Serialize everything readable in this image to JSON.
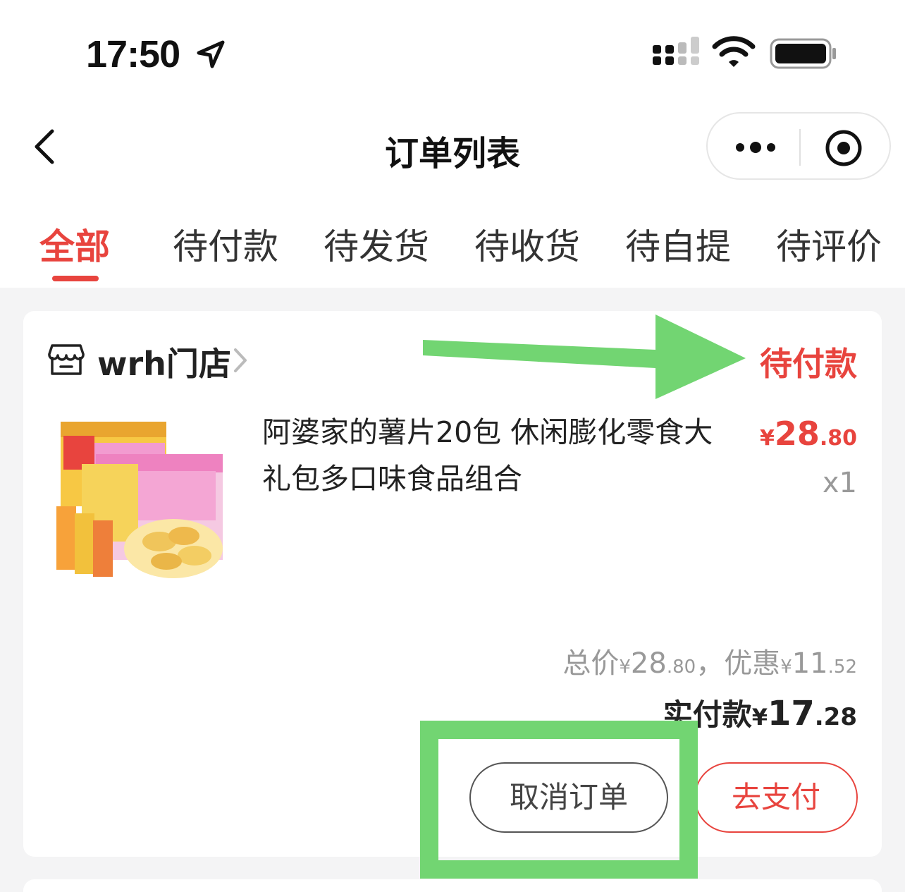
{
  "status_bar": {
    "time": "17:50"
  },
  "nav": {
    "title": "订单列表"
  },
  "tabs": [
    {
      "label": "全部",
      "active": true
    },
    {
      "label": "待付款",
      "active": false
    },
    {
      "label": "待发货",
      "active": false
    },
    {
      "label": "待收货",
      "active": false
    },
    {
      "label": "待自提",
      "active": false
    },
    {
      "label": "待评价",
      "active": false
    }
  ],
  "order": {
    "store_name": "wrh门店",
    "status": "待付款",
    "product": {
      "title": "阿婆家的薯片20包 休闲膨化零食大礼包多口味食品组合",
      "price_symbol": "¥",
      "price_int": "28",
      "price_dec": ".80",
      "quantity": "x1"
    },
    "summary": {
      "total_label": "总价",
      "total_symbol": "¥",
      "total_int": "28",
      "total_dec": ".80",
      "sep": "，",
      "discount_label": "优惠",
      "discount_symbol": "¥",
      "discount_int": "11",
      "discount_dec": ".52"
    },
    "paid": {
      "label": "实付款",
      "symbol": "¥",
      "int": "17",
      "dec": ".28"
    },
    "actions": {
      "cancel": "取消订单",
      "pay": "去支付"
    }
  },
  "colors": {
    "accent": "#e8443e",
    "annotation": "#72d572",
    "background": "#f4f4f5"
  },
  "icons": [
    "location-arrow-icon",
    "signal-icon",
    "wifi-icon",
    "battery-icon",
    "back-icon",
    "more-icon",
    "target-icon",
    "store-icon",
    "chevron-right-icon"
  ]
}
